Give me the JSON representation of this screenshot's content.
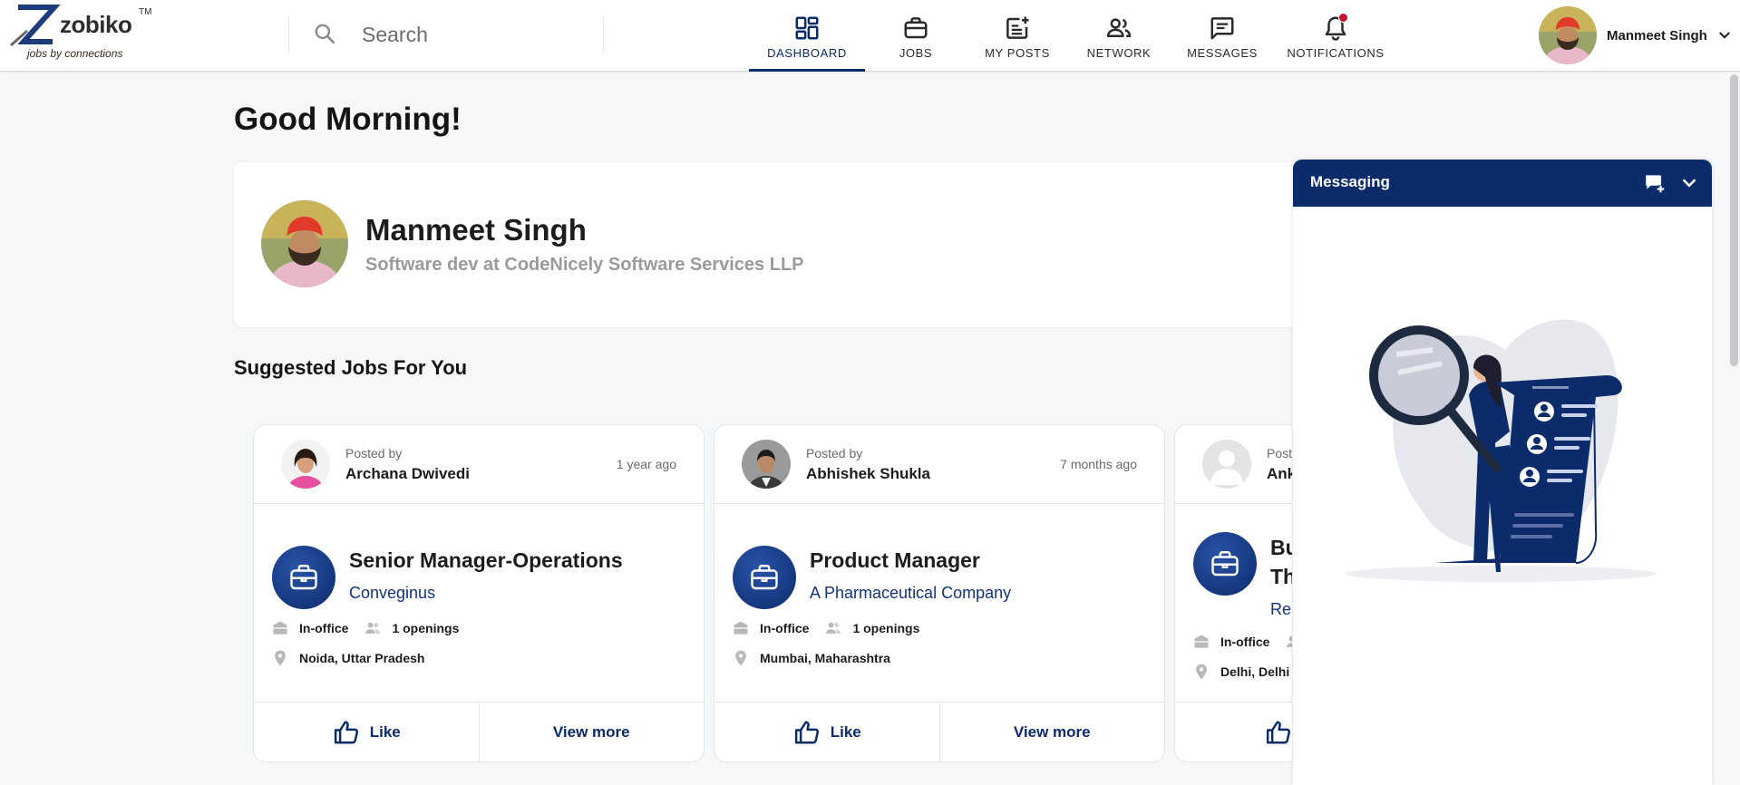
{
  "brand": {
    "name": "zobiko",
    "tm": "TM",
    "tagline": "jobs by connections",
    "accent": "#0b2b6b",
    "alert": "#c8102e"
  },
  "search": {
    "placeholder": "Search",
    "value": "",
    "icon": "search-icon"
  },
  "nav": {
    "items": [
      {
        "label": "DASHBOARD",
        "icon": "dashboard-icon",
        "active": true
      },
      {
        "label": "JOBS",
        "icon": "briefcase-icon"
      },
      {
        "label": "MY POSTS",
        "icon": "post-add-icon"
      },
      {
        "label": "NETWORK",
        "icon": "people-icon"
      },
      {
        "label": "MESSAGES",
        "icon": "message-icon"
      },
      {
        "label": "NOTIFICATIONS",
        "icon": "bell-icon",
        "has_alert": true
      }
    ]
  },
  "user": {
    "name": "Manmeet Singh",
    "role": "Software dev at CodeNicely Software Services LLP"
  },
  "greeting": "Good Morning!",
  "suggested_title": "Suggested Jobs For You",
  "posted_by_label": "Posted by",
  "jobs": [
    {
      "poster": "Archana Dwivedi",
      "time": "1 year ago",
      "title": "Senior Manager-Operations",
      "company": "Conveginus",
      "work_mode": "In-office",
      "openings": "1 openings",
      "location": "Noida, Uttar Pradesh",
      "like": "Like",
      "view_more": "View more"
    },
    {
      "poster": "Abhishek Shukla",
      "time": "7 months ago",
      "title": "Product Manager",
      "company": "A Pharmaceutical Company",
      "work_mode": "In-office",
      "openings": "1 openings",
      "location": "Mumbai, Maharashtra",
      "like": "Like",
      "view_more": "View more"
    },
    {
      "poster": "Ank",
      "poster_prefix": "Poste",
      "title_line1": "Bu",
      "title_line2": "Th",
      "company": "Rep",
      "work_mode": "In-office",
      "location": "Delhi, Delhi",
      "like": "L"
    }
  ],
  "messaging": {
    "title": "Messaging",
    "new_icon": "new-chat-icon",
    "collapse_icon": "chevron-down-icon"
  }
}
